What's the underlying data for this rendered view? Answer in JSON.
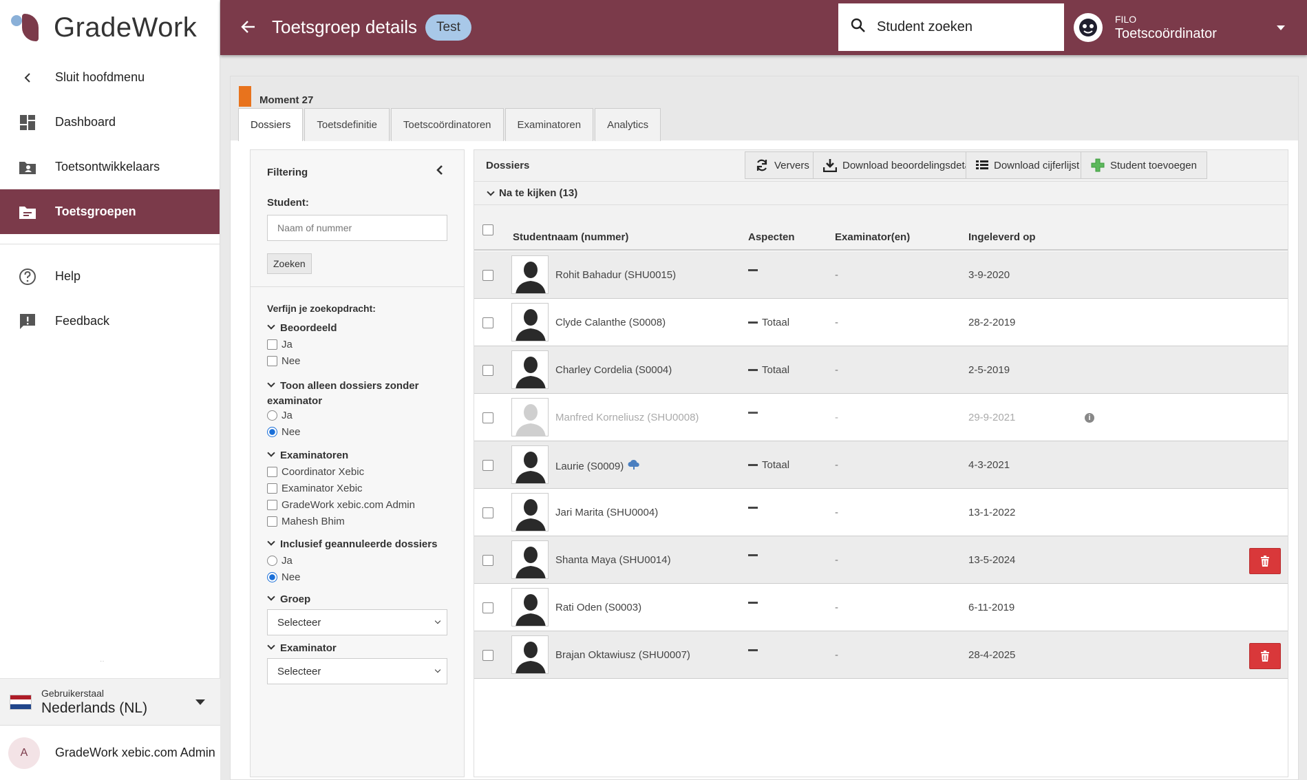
{
  "brand": {
    "name": "GradeWork"
  },
  "sidebar": {
    "items": [
      {
        "label": "Sluit hoofdmenu",
        "icon": "chevron-left-icon"
      },
      {
        "label": "Dashboard",
        "icon": "dashboard-icon"
      },
      {
        "label": "Toetsontwikkelaars",
        "icon": "folder-user-icon"
      },
      {
        "label": "Toetsgroepen",
        "icon": "folder-list-icon",
        "active": true
      },
      {
        "label": "Help",
        "icon": "help-icon"
      },
      {
        "label": "Feedback",
        "icon": "feedback-icon"
      }
    ],
    "language": {
      "label": "Gebruikerstaal",
      "value": "Nederlands (NL)"
    },
    "user": {
      "initial": "A",
      "name": "GradeWork xebic.com Admin"
    }
  },
  "header": {
    "title": "Toetsgroep details",
    "badge": "Test",
    "search_placeholder": "Student zoeken",
    "org": "FILO",
    "role": "Toetscoördinator"
  },
  "panel": {
    "moment": "Moment 27",
    "tabs": [
      "Dossiers",
      "Toetsdefinitie",
      "Toetscoördinatoren",
      "Examinatoren",
      "Analytics"
    ]
  },
  "filter": {
    "title": "Filtering",
    "student_label": "Student:",
    "student_placeholder": "Naam of nummer",
    "search_button": "Zoeken",
    "refine_label": "Verfijn je zoekopdracht:",
    "groups": {
      "beoordeeld": {
        "title": "Beoordeeld",
        "options": [
          "Ja",
          "Nee"
        ]
      },
      "zonder_examinator": {
        "title": "Toon alleen dossiers zonder examinator",
        "title_line1": "Toon alleen dossiers zonder",
        "title_line2": "examinator",
        "options": [
          "Ja",
          "Nee"
        ],
        "selected": "Nee"
      },
      "examinatoren": {
        "title": "Examinatoren",
        "options": [
          "Coordinator Xebic",
          "Examinator Xebic",
          "GradeWork xebic.com Admin",
          "Mahesh Bhim"
        ]
      },
      "geannuleerd": {
        "title": "Inclusief geannuleerde dossiers",
        "options": [
          "Ja",
          "Nee"
        ],
        "selected": "Nee"
      },
      "groep": {
        "title": "Groep",
        "value": "Selecteer"
      },
      "examinator": {
        "title": "Examinator",
        "value": "Selecteer"
      }
    }
  },
  "dossiers": {
    "title": "Dossiers",
    "buttons": {
      "refresh": "Ververs",
      "download_details": "Download beoordelingsdetails",
      "download_grades": "Download cijferlijst",
      "add_student": "Student toevoegen"
    },
    "section": "Na te kijken (13)",
    "columns": [
      "Studentnaam (nummer)",
      "Aspecten",
      "Examinator(en)",
      "Ingeleverd op"
    ],
    "rows": [
      {
        "name": "Rohit Bahadur (SHU0015)",
        "aspect": "",
        "examiner": "-",
        "date": "3-9-2020"
      },
      {
        "name": "Clyde Calanthe (S0008)",
        "aspect": "Totaal",
        "examiner": "-",
        "date": "28-2-2019"
      },
      {
        "name": "Charley Cordelia (S0004)",
        "aspect": "Totaal",
        "examiner": "-",
        "date": "2-5-2019"
      },
      {
        "name": "Manfred Korneliusz (SHU0008)",
        "aspect": "",
        "examiner": "-",
        "date": "29-9-2021",
        "dimmed": true,
        "info": true
      },
      {
        "name": "Laurie (S0009)",
        "aspect": "Totaal",
        "examiner": "-",
        "date": "4-3-2021",
        "upload": true
      },
      {
        "name": "Jari Marita (SHU0004)",
        "aspect": "",
        "examiner": "-",
        "date": "13-1-2022"
      },
      {
        "name": "Shanta Maya (SHU0014)",
        "aspect": "",
        "examiner": "-",
        "date": "13-5-2024",
        "delete": true
      },
      {
        "name": "Rati Oden (S0003)",
        "aspect": "",
        "examiner": "-",
        "date": "6-11-2019"
      },
      {
        "name": "Brajan Oktawiusz (SHU0007)",
        "aspect": "",
        "examiner": "-",
        "date": "28-4-2025",
        "delete": true
      }
    ]
  },
  "colors": {
    "brand": "#7b3a4a",
    "accent": "#e8731d",
    "danger": "#d9383a",
    "badge": "#a8c8e8"
  }
}
